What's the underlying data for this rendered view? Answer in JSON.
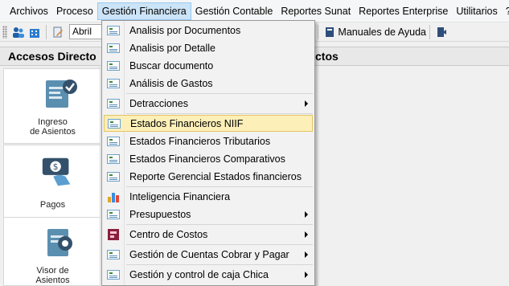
{
  "menubar": {
    "items": [
      "Archivos",
      "Proceso",
      "Gestión Financiera",
      "Gestión Contable",
      "Reportes Sunat",
      "Reportes Enterprise",
      "Utilitarios",
      "?"
    ]
  },
  "toolbar": {
    "month_value": "Abril",
    "manuals_label": "Manuales de Ayuda"
  },
  "accesos": {
    "title": "Accesos Directo",
    "title_right": "ctos"
  },
  "shortcuts": [
    {
      "label": "Ingreso\nde Asientos"
    },
    {
      "label": "Pagos"
    },
    {
      "label": "Visor de\nAsientos"
    }
  ],
  "dropdown": {
    "items": [
      {
        "label": "Analisis por Documentos"
      },
      {
        "label": "Analisis por Detalle"
      },
      {
        "label": "Buscar documento"
      },
      {
        "label": "Análisis de Gastos"
      },
      {
        "label": "Detracciones"
      },
      {
        "label": "Estados Financieros NIIF"
      },
      {
        "label": "Estados Financieros Tributarios"
      },
      {
        "label": "Estados Financieros Comparativos"
      },
      {
        "label": "Reporte Gerencial Estados financieros"
      },
      {
        "label": "Inteligencia Financiera"
      },
      {
        "label": "Presupuestos"
      },
      {
        "label": "Centro de Costos"
      },
      {
        "label": "Gestión de Cuentas Cobrar y Pagar"
      },
      {
        "label": "Gestión y control de caja Chica"
      }
    ]
  },
  "colors": {
    "highlight_bg": "#fcefb8",
    "menu_active_bg": "#cce4f7"
  }
}
